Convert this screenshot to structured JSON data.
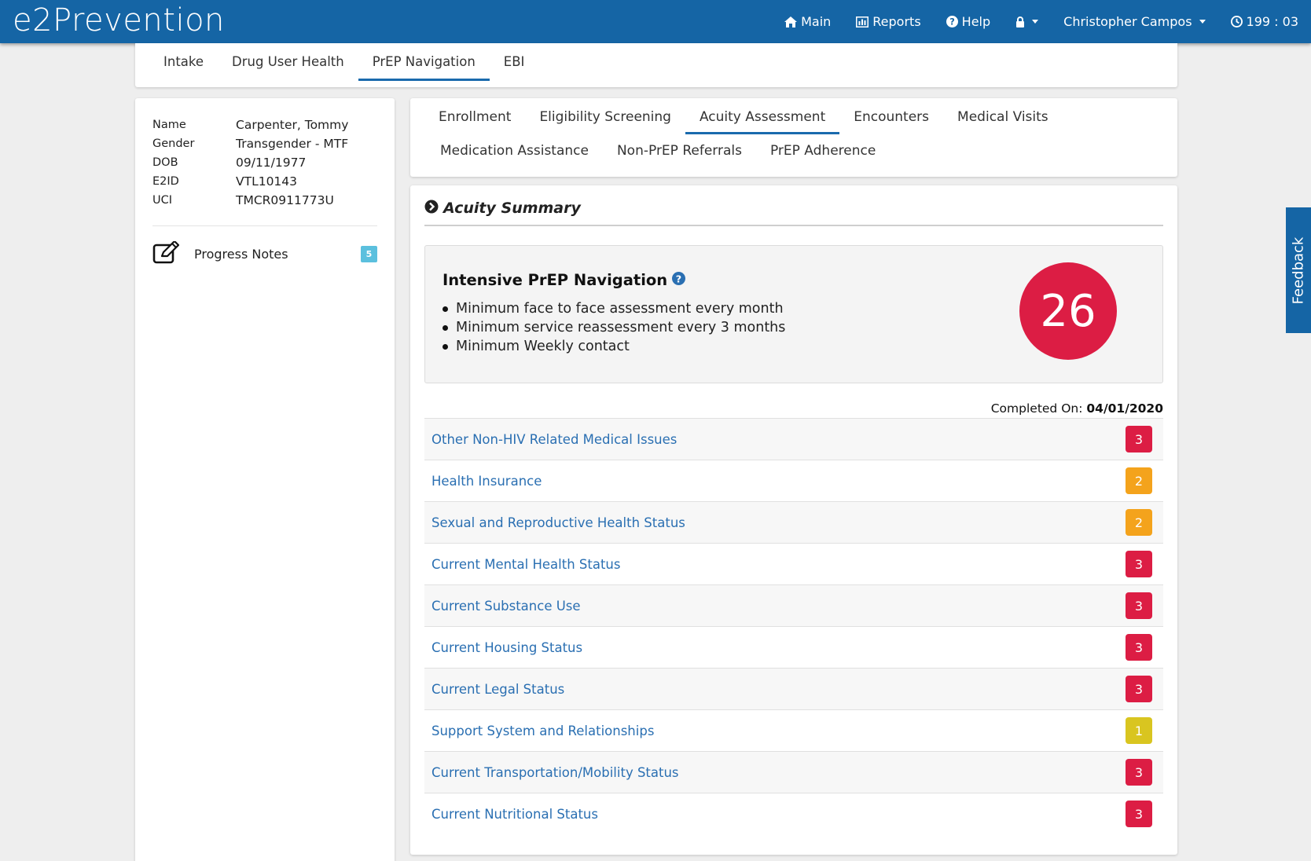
{
  "app": {
    "brand": "e2Prevention"
  },
  "topnav": {
    "main": "Main",
    "reports": "Reports",
    "help": "Help",
    "user": "Christopher Campos",
    "timer": "199 : 03"
  },
  "main_tabs": [
    "Intake",
    "Drug User Health",
    "PrEP Navigation",
    "EBI"
  ],
  "main_tabs_active": "PrEP Navigation",
  "client": {
    "labels": {
      "name": "Name",
      "gender": "Gender",
      "dob": "DOB",
      "e2id": "E2ID",
      "uci": "UCI"
    },
    "values": {
      "name": "Carpenter, Tommy",
      "gender": "Transgender - MTF",
      "dob": "09/11/1977",
      "e2id": "VTL10143",
      "uci": "TMCR0911773U"
    }
  },
  "progress_notes": {
    "label": "Progress Notes",
    "count": "5"
  },
  "sub_tabs": {
    "row1": [
      "Enrollment",
      "Eligibility Screening",
      "Acuity Assessment",
      "Encounters",
      "Medical Visits"
    ],
    "row2": [
      "Medication Assistance",
      "Non-PrEP Referrals",
      "PrEP Adherence"
    ],
    "active": "Acuity Assessment"
  },
  "summary": {
    "title": "Acuity Summary",
    "level_title": "Intensive PrEP Navigation",
    "requirements": [
      "Minimum face to face assessment every month",
      "Minimum service reassessment every 3 months",
      "Minimum Weekly contact"
    ],
    "total_score": "26",
    "completed_label": "Completed On:",
    "completed_date": "04/01/2020",
    "items": [
      {
        "label": "Other Non-HIV Related Medical Issues",
        "score": "3"
      },
      {
        "label": "Health Insurance",
        "score": "2"
      },
      {
        "label": "Sexual and Reproductive Health Status",
        "score": "2"
      },
      {
        "label": "Current Mental Health Status",
        "score": "3"
      },
      {
        "label": "Current Substance Use",
        "score": "3"
      },
      {
        "label": "Current Housing Status",
        "score": "3"
      },
      {
        "label": "Current Legal Status",
        "score": "3"
      },
      {
        "label": "Support System and Relationships",
        "score": "1"
      },
      {
        "label": "Current Transportation/Mobility Status",
        "score": "3"
      },
      {
        "label": "Current Nutritional Status",
        "score": "3"
      }
    ]
  },
  "feedback": "Feedback",
  "colors": {
    "primary": "#1565a5",
    "link": "#2a6fb2",
    "score_3": "#dc1d44",
    "score_2": "#f4a31c",
    "score_1": "#d9c520",
    "notes_badge": "#5bc0de"
  },
  "icons": [
    "home-icon",
    "bar-chart-icon",
    "question-circle-icon",
    "lock-icon",
    "clock-icon",
    "edit-note-icon",
    "chevron-right-circle-icon",
    "help-circle-icon"
  ]
}
